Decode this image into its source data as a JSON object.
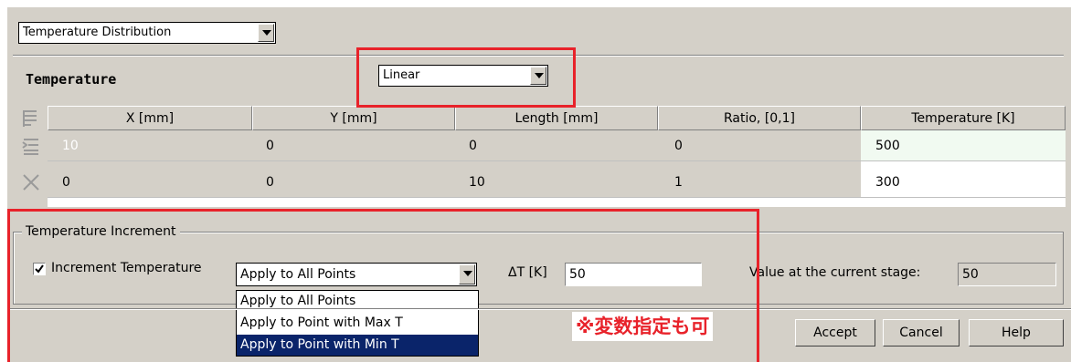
{
  "top_combo": {
    "value": "Temperature Distribution"
  },
  "section": {
    "title": "Temperature",
    "mode_value": "Linear"
  },
  "table": {
    "columns": [
      "X [mm]",
      "Y [mm]",
      "Length [mm]",
      "Ratio, [0,1]",
      "Temperature [K]"
    ],
    "rows": [
      {
        "x": "10",
        "y": "0",
        "length": "0",
        "ratio": "0",
        "temperature": "500"
      },
      {
        "x": "0",
        "y": "0",
        "length": "10",
        "ratio": "1",
        "temperature": "300"
      }
    ]
  },
  "increment": {
    "group_label": "Temperature Increment",
    "checkbox_label": "Increment Temperature",
    "checkbox_checked": true,
    "apply_value": "Apply to All Points",
    "options": [
      "Apply to All Points",
      "Apply to Point with Max T",
      "Apply to Point with Min T"
    ],
    "highlighted_option": "Apply to Point with Min T",
    "delta_label": "ΔT [K]",
    "delta_value": "50",
    "current_label": "Value at the current stage:",
    "current_value": "50"
  },
  "annotation": {
    "text": "※変数指定も可",
    "color": "#e8222a"
  },
  "buttons": {
    "accept": "Accept",
    "cancel": "Cancel",
    "help": "Help"
  },
  "colors": {
    "panel": "#d4d0c8",
    "highlight": "#0a246a",
    "annotation_red": "#e8222a",
    "temp_cell": "#f1faf1"
  }
}
